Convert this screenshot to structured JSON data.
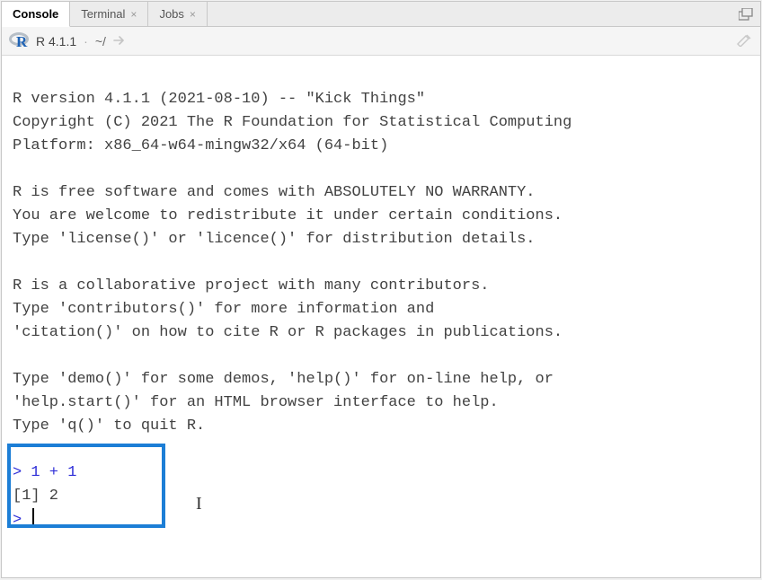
{
  "tabs": [
    {
      "label": "Console",
      "closable": false
    },
    {
      "label": "Terminal",
      "closable": true
    },
    {
      "label": "Jobs",
      "closable": true
    }
  ],
  "subbar": {
    "version": "R 4.1.1",
    "path": "~/"
  },
  "console": {
    "banner_lines": [
      "R version 4.1.1 (2021-08-10) -- \"Kick Things\"",
      "Copyright (C) 2021 The R Foundation for Statistical Computing",
      "Platform: x86_64-w64-mingw32/x64 (64-bit)",
      "",
      "R is free software and comes with ABSOLUTELY NO WARRANTY.",
      "You are welcome to redistribute it under certain conditions.",
      "Type 'license()' or 'licence()' for distribution details.",
      "",
      "R is a collaborative project with many contributors.",
      "Type 'contributors()' for more information and",
      "'citation()' on how to cite R or R packages in publications.",
      "",
      "Type 'demo()' for some demos, 'help()' for on-line help, or",
      "'help.start()' for an HTML browser interface to help.",
      "Type 'q()' to quit R.",
      ""
    ],
    "input_line": "1 + 1",
    "output_line": "[1] 2",
    "prompt": ">"
  }
}
